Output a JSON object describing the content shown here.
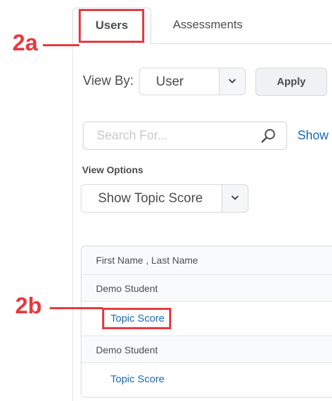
{
  "tabs": {
    "users": "Users",
    "assessments": "Assessments"
  },
  "view_by": {
    "label": "View By:",
    "selected": "User",
    "apply_label": "Apply"
  },
  "search": {
    "placeholder": "Search For...",
    "show_link": "Show"
  },
  "view_options": {
    "label": "View Options",
    "selected": "Show Topic Score"
  },
  "table": {
    "header": "First Name , Last Name",
    "rows": [
      {
        "student": "Demo Student",
        "link": "Topic Score"
      },
      {
        "student": "Demo Student",
        "link": "Topic Score"
      }
    ]
  },
  "annotations": {
    "step_a": "2a",
    "step_b": "2b",
    "color": "#e8383d"
  },
  "colors": {
    "link": "#1a69b5",
    "text": "#494c4e"
  }
}
